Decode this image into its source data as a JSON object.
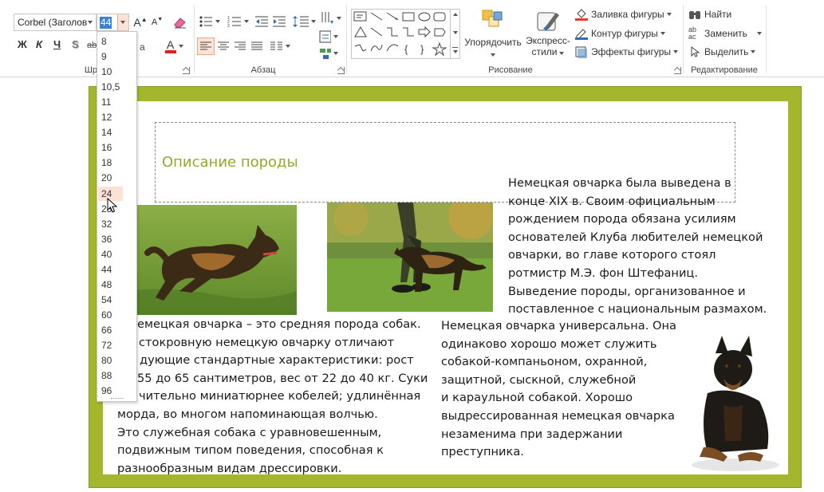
{
  "ribbon": {
    "font": {
      "name": "Corbel (Заголов",
      "size": "44",
      "group_label": "Шри",
      "bold": "Ж",
      "italic": "К",
      "underline": "Ч",
      "shadow": "S",
      "strike": "abc",
      "grow": "A",
      "shrink": "A"
    },
    "paragraph": {
      "group_label": "Абзац"
    },
    "drawing": {
      "group_label": "Рисование",
      "arrange": "Упорядочить",
      "quick_styles_1": "Экспресс-",
      "quick_styles_2": "стили",
      "fill": "Заливка фигуры",
      "outline": "Контур фигуры",
      "effects": "Эффекты фигуры"
    },
    "editing": {
      "group_label": "Редактирование",
      "find": "Найти",
      "replace": "Заменить",
      "select": "Выделить"
    }
  },
  "font_size_list": [
    "8",
    "9",
    "10",
    "10,5",
    "11",
    "12",
    "14",
    "16",
    "18",
    "20",
    "24",
    "28",
    "32",
    "36",
    "40",
    "44",
    "48",
    "54",
    "60",
    "66",
    "72",
    "80",
    "88",
    "96"
  ],
  "font_size_hover": "24",
  "colors": {
    "accent_green": "#a4b62b",
    "title_green": "#93a92a",
    "hover": "#fce1d7",
    "selection_blue": "#3c7fd6"
  },
  "slide": {
    "title": "Описание породы",
    "col_right_top": [
      "Немецкая овчарка была выведена в",
      "конце XIX в. Своим официальным",
      "рождением порода обязана усилиям",
      "основателей Клуба любителей немецкой",
      "овчарки, во главе которого стоял",
      "ротмистр М.Э. фон Штефаниц.",
      "Выведение породы, организованное и",
      "поставленное с национальным размахом."
    ],
    "col_left": [
      "емецкая овчарка – это средняя порода собак.",
      "стокровную немецкую овчарку отличают",
      "дующие стандартные характеристики: рост",
      "55 до 65 сантиметров, вес от 22 до 40 кг. Суки",
      "чительно миниатюрнее кобелей; удлинённая",
      "морда, во многом напоминающая волчью.",
      "Это служебная собака с уравновешенным,",
      "подвижным типом поведения, способная к",
      "разнообразным видам дрессировки."
    ],
    "col_middle": [
      "Немецкая овчарка универсальна. Она",
      "одинаково хорошо может служить",
      "собакой-компаньоном, охранной,",
      "защитной, сыскной, служебной",
      "и караульной собакой. Хорошо",
      "выдрессированная немецкая овчарка",
      "незаменима при задержании",
      "преступника."
    ]
  }
}
